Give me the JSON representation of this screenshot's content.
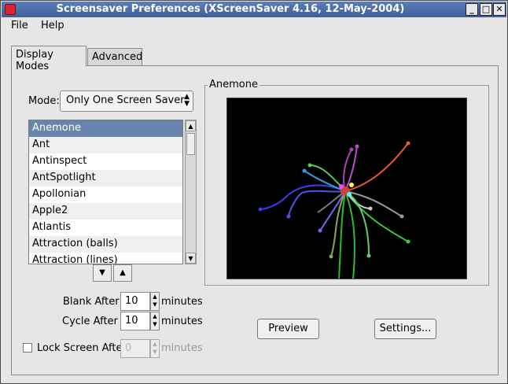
{
  "window": {
    "title": "Screensaver Preferences  (XScreenSaver 4.16, 12-May-2004)"
  },
  "titlebar_buttons": {
    "minimize": "_",
    "maximize": "□",
    "close": "✕"
  },
  "menu": {
    "file": "File",
    "help": "Help"
  },
  "tabs": [
    {
      "label": "Display Modes"
    },
    {
      "label": "Advanced"
    }
  ],
  "mode": {
    "label": "Mode:",
    "value": "Only One Screen Saver"
  },
  "screensavers": [
    "Anemone",
    "Ant",
    "Antinspect",
    "AntSpotlight",
    "Apollonian",
    "Apple2",
    "Atlantis",
    "Attraction (balls)",
    "Attraction (lines)"
  ],
  "selected_index": 0,
  "list_nav": {
    "down": "▼",
    "up": "▲"
  },
  "blank_after": {
    "label": "Blank After",
    "value": "10",
    "unit": "minutes"
  },
  "cycle_after": {
    "label": "Cycle After",
    "value": "10",
    "unit": "minutes"
  },
  "lock_screen": {
    "label": "Lock Screen After",
    "value": "0",
    "unit": "minutes",
    "checked": false
  },
  "preview_frame": {
    "label": "Anemone"
  },
  "buttons": {
    "preview": "Preview",
    "settings": "Settings..."
  }
}
